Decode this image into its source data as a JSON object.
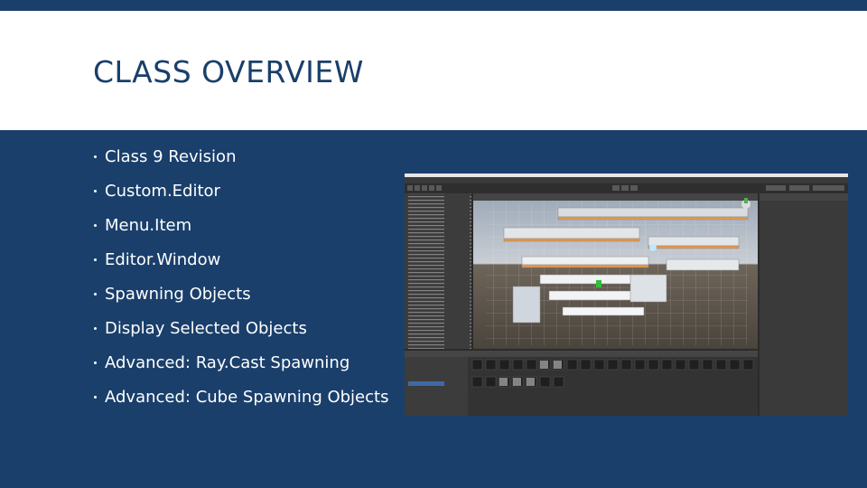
{
  "slide": {
    "title": "CLASS OVERVIEW",
    "bullets": [
      "Class 9 Revision",
      "Custom.Editor",
      "Menu.Item",
      "Editor.Window",
      "Spawning Objects",
      "Display Selected Objects",
      "Advanced: Ray.Cast Spawning",
      "Advanced: Cube Spawning Objects"
    ]
  },
  "colors": {
    "background": "#1a3f6b",
    "title_band": "#ffffff",
    "title_text": "#1a3f6b",
    "bullet_text": "#ffffff",
    "editor_dark": "#2b2b2b",
    "highlight_orange": "#e8964a"
  },
  "screenshot": {
    "description_icon": "unity-editor-screenshot"
  }
}
